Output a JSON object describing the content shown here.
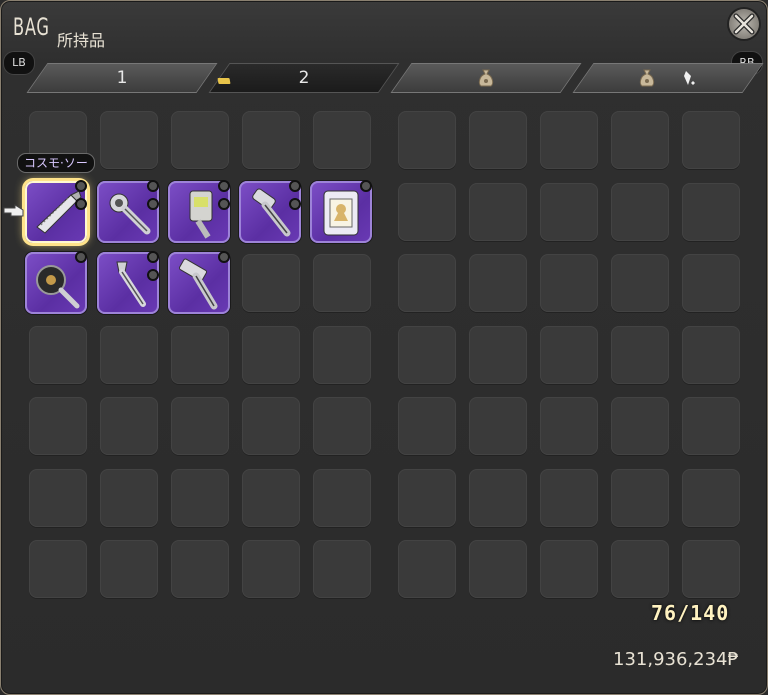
{
  "window": {
    "title_en": "BAG",
    "title_jp": "所持品"
  },
  "buttons": {
    "left": "LB",
    "right": "RB"
  },
  "tabs": [
    {
      "label": "1",
      "active": false,
      "icon": ""
    },
    {
      "label": "2",
      "active": true,
      "icon": ""
    },
    {
      "label": "",
      "active": false,
      "icon": "money-bag-icon"
    },
    {
      "label": "",
      "active": false,
      "icon": "money-bag-crystal-icon"
    }
  ],
  "tooltip": "コスモ·ソー",
  "items": [
    {
      "name": "saw-item",
      "selected": true
    },
    {
      "name": "wrench-item",
      "selected": false
    },
    {
      "name": "gauge-tool-item",
      "selected": false
    },
    {
      "name": "hammer-item",
      "selected": false
    },
    {
      "name": "frame-item",
      "selected": false
    },
    {
      "name": "pan-item",
      "selected": false
    },
    {
      "name": "spanner-item",
      "selected": false
    },
    {
      "name": "mallet-item",
      "selected": false
    }
  ],
  "inventory_count": "76/140",
  "gil": "131,936,234₱"
}
